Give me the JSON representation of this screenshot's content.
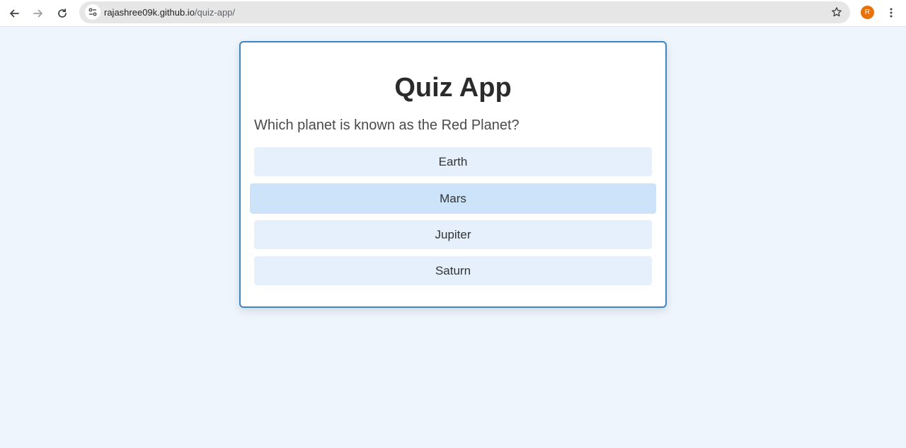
{
  "browser": {
    "url_host": "rajashree09k.github.io",
    "url_path": "/quiz-app/",
    "profile_initial": "R",
    "icons": {
      "back": "back-arrow-icon",
      "forward": "forward-arrow-icon",
      "reload": "reload-icon",
      "site_info": "tune-icon",
      "bookmark": "star-icon",
      "menu": "kebab-menu-icon"
    },
    "colors": {
      "profile": "#e8710a"
    }
  },
  "quiz": {
    "title": "Quiz App",
    "question": "Which planet is known as the Red Planet?",
    "options": [
      {
        "label": "Earth"
      },
      {
        "label": "Mars",
        "hovered": true
      },
      {
        "label": "Jupiter"
      },
      {
        "label": "Saturn"
      }
    ],
    "colors": {
      "background": "#eef5fd",
      "card_border": "#3a86c8",
      "option_bg": "#e6f0fc",
      "option_hover_bg": "#cce3f9"
    }
  }
}
